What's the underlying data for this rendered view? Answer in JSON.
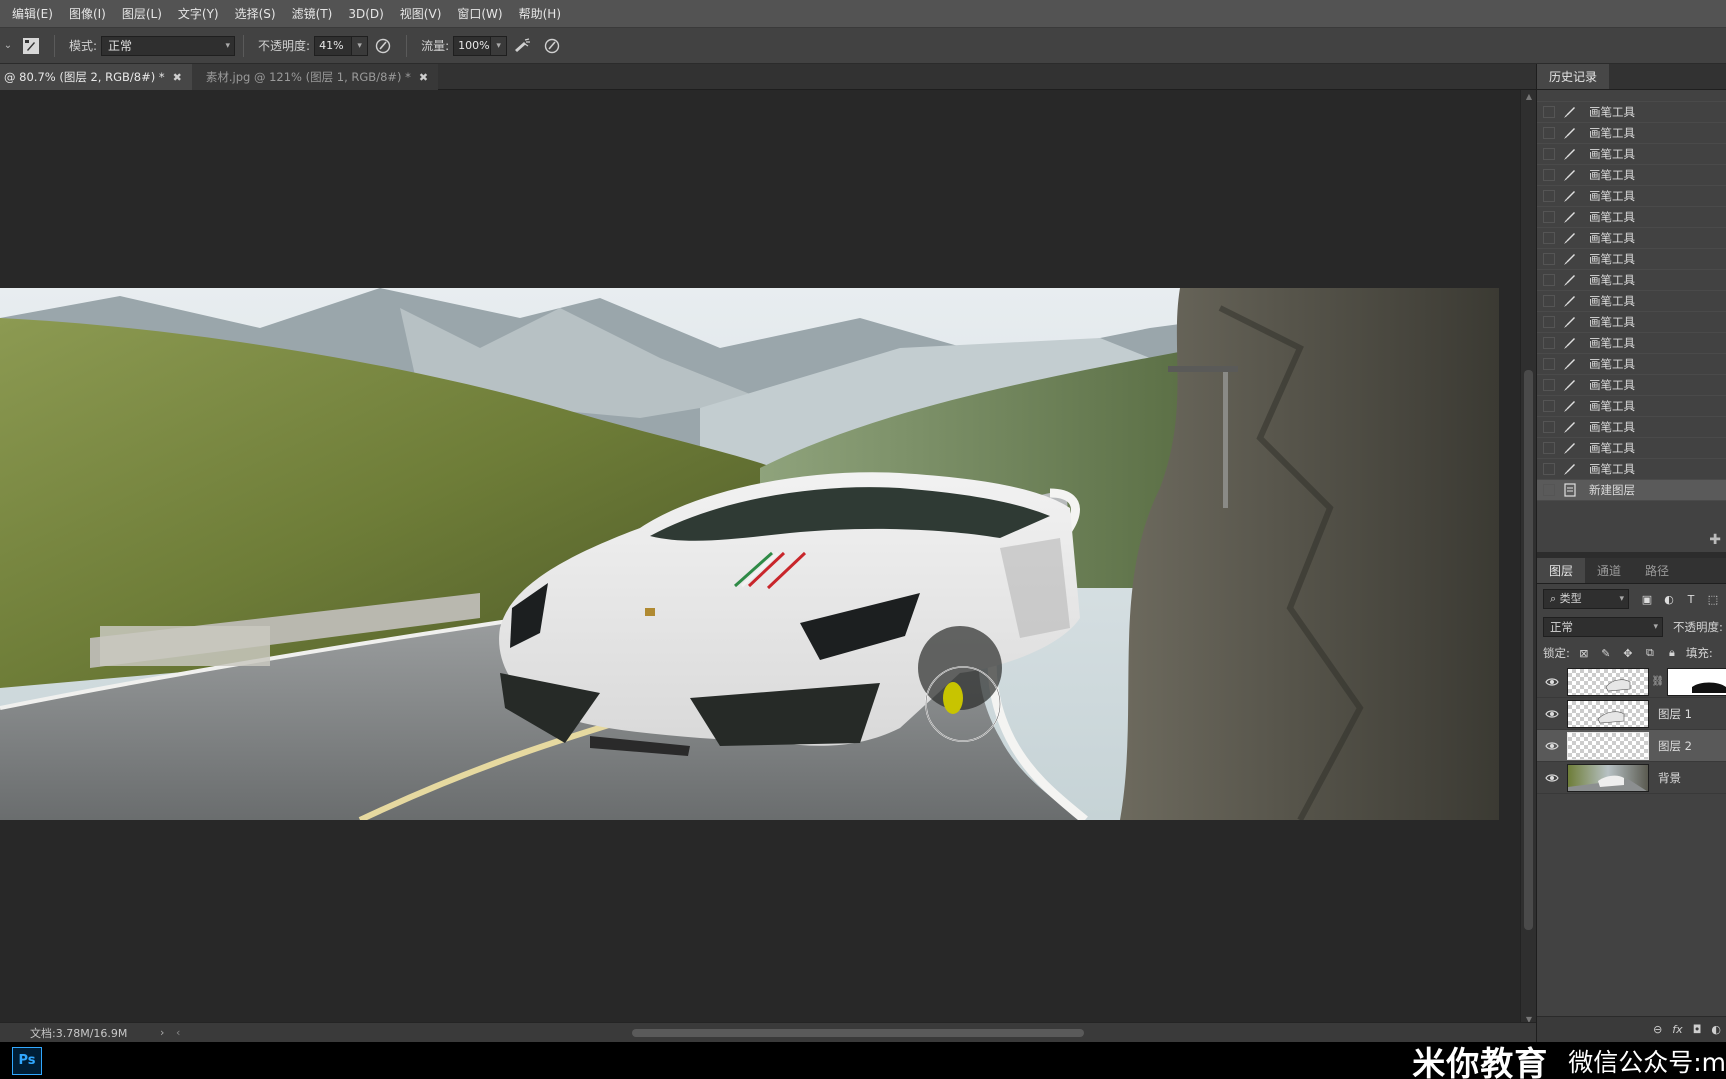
{
  "menu": [
    "编辑(E)",
    "图像(I)",
    "图层(L)",
    "文字(Y)",
    "选择(S)",
    "滤镜(T)",
    "3D(D)",
    "视图(V)",
    "窗口(W)",
    "帮助(H)"
  ],
  "options": {
    "mode_label": "模式:",
    "mode_value": "正常",
    "opacity_label": "不透明度:",
    "opacity_value": "41%",
    "flow_label": "流量:",
    "flow_value": "100%"
  },
  "tabs": [
    {
      "label": "@ 80.7% (图层 2, RGB/8#) *",
      "active": true
    },
    {
      "label": "素材.jpg @ 121% (图层 1, RGB/8#) *",
      "active": false
    }
  ],
  "status": {
    "doc_info": "文档:3.78M/16.9M"
  },
  "history": {
    "tab_label": "历史记录",
    "items": [
      {
        "label": "画笔工具",
        "icon": "brush-icon"
      },
      {
        "label": "画笔工具",
        "icon": "brush-icon"
      },
      {
        "label": "画笔工具",
        "icon": "brush-icon"
      },
      {
        "label": "画笔工具",
        "icon": "brush-icon"
      },
      {
        "label": "画笔工具",
        "icon": "brush-icon"
      },
      {
        "label": "画笔工具",
        "icon": "brush-icon"
      },
      {
        "label": "画笔工具",
        "icon": "brush-icon"
      },
      {
        "label": "画笔工具",
        "icon": "brush-icon"
      },
      {
        "label": "画笔工具",
        "icon": "brush-icon"
      },
      {
        "label": "画笔工具",
        "icon": "brush-icon"
      },
      {
        "label": "画笔工具",
        "icon": "brush-icon"
      },
      {
        "label": "画笔工具",
        "icon": "brush-icon"
      },
      {
        "label": "画笔工具",
        "icon": "brush-icon"
      },
      {
        "label": "画笔工具",
        "icon": "brush-icon"
      },
      {
        "label": "画笔工具",
        "icon": "brush-icon"
      },
      {
        "label": "画笔工具",
        "icon": "brush-icon"
      },
      {
        "label": "画笔工具",
        "icon": "brush-icon"
      },
      {
        "label": "画笔工具",
        "icon": "brush-icon"
      },
      {
        "label": "新建图层",
        "icon": "new-layer-icon"
      }
    ]
  },
  "layers": {
    "tabs": [
      "图层",
      "通道",
      "路径"
    ],
    "filter_kind": "类型",
    "blend_mode": "正常",
    "opacity_label": "不透明度:",
    "lock_label": "锁定:",
    "fill_label": "填充:",
    "items": [
      {
        "name": "",
        "visible": true,
        "has_mask": true
      },
      {
        "name": "图层 1",
        "visible": true,
        "has_mask": false
      },
      {
        "name": "图层 2",
        "visible": true,
        "has_mask": false,
        "selected": true
      },
      {
        "name": "背景",
        "visible": true,
        "has_mask": false
      }
    ]
  },
  "taskbar": {
    "app": "Ps"
  },
  "watermark": {
    "brand": "米你教育",
    "wechat": "微信公众号:m"
  },
  "colors": {
    "menubar": "#535353",
    "options": "#424242",
    "canvas": "#282828",
    "panel": "#424242",
    "accent": "#31a8ff"
  }
}
